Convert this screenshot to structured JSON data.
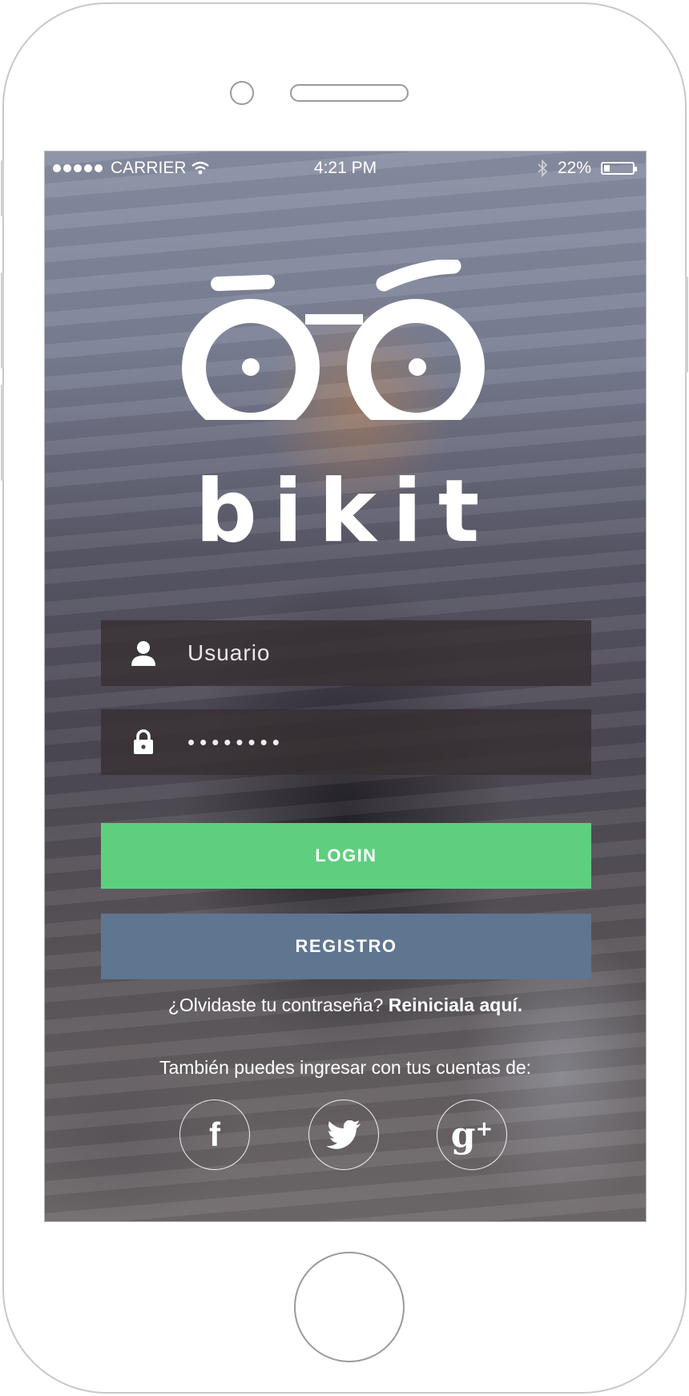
{
  "status_bar": {
    "carrier": "CARRIER",
    "time": "4:21 PM",
    "battery_percent": "22%",
    "battery_level": 0.22
  },
  "brand": {
    "name": "bikit"
  },
  "login_form": {
    "username_placeholder": "Usuario",
    "password_value": "••••••••",
    "login_label": "LOGIN",
    "register_label": "REGISTRO"
  },
  "forgot": {
    "question": "¿Olvidaste tu contraseña?",
    "link": "Reiniciala aquí."
  },
  "social": {
    "prompt": "También puedes ingresar con tus cuentas de:",
    "facebook_glyph": "f",
    "google_glyph": "g",
    "google_plus": "+"
  },
  "colors": {
    "login": "#5ecf7e",
    "register": "#5f7590"
  },
  "icons": [
    "signal-dots-icon",
    "wifi-icon",
    "bluetooth-icon",
    "battery-icon",
    "user-icon",
    "lock-icon",
    "facebook-icon",
    "twitter-icon",
    "google-plus-icon"
  ]
}
